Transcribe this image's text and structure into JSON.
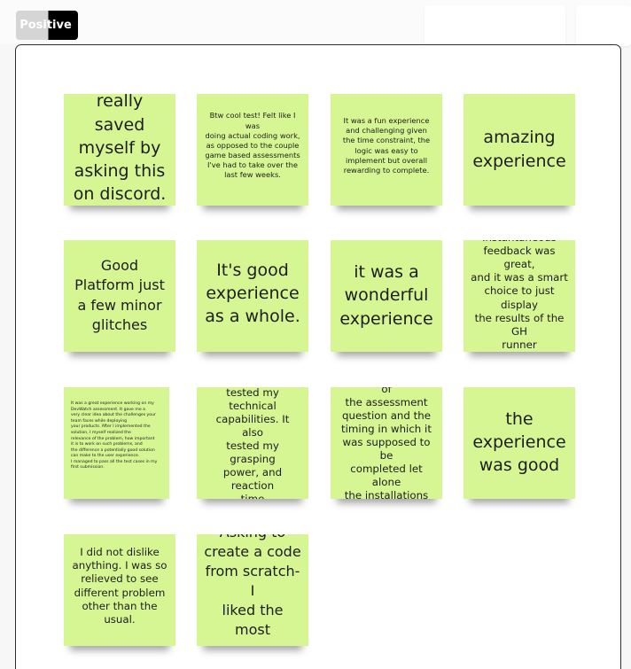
{
  "board": {
    "tag_label": "Positive",
    "notes": [
      {
        "text": "really saved\nmyself by\nasking this\non discord."
      },
      {
        "text": "Btw cool test! Felt like I was\ndoing actual coding work,\nas opposed to the couple\ngame based assessments\nI've had to take over the\nlast few weeks."
      },
      {
        "text": "It was a fun experience\nand challenging given\nthe time constraint, the\nlogic was easy to\nimplement but overall\nrewarding to complete."
      },
      {
        "text": "amazing\nexperience"
      },
      {
        "text": "Good\nPlatform just\na few minor\nglitches"
      },
      {
        "text": "It's good\nexperience\nas a whole."
      },
      {
        "text": "it was a\nwonderful\nexperience"
      },
      {
        "text": "Instantaneous\nfeedback was great,\nand it was a smart\nchoice to just display\nthe results of the GH\nrunner"
      },
      {
        "text": "It was a great experience working on my\nDevWatch assessment. It gave me a\nvery clear idea about the challenges your\nteam faces while deploying\nyour products. After I implemented the\nsolution, I myself realized the\nrelevance of the problem, how important\nit is to work on such problems, and\nthe difference a potentially good solution\ncan make to the user experience.\nI managed to pass all the test cases in my\nfirst submission."
      },
      {
        "text": "It was great! It\ntested my technical\ncapabilities. It also\ntested my grasping\npower, and reaction\ntime"
      },
      {
        "text": "The realisticness of\nthe assessment\nquestion and the\ntiming in which it\nwas supposed to be\ncompleted let alone\nthe installations"
      },
      {
        "text": "the\nexperience\nwas good"
      },
      {
        "text": "I did not dislike\nanything. I was so\nrelieved to see\ndifferent problem\nother than the\nusual."
      },
      {
        "text": "Asking to\ncreate a code\nfrom scratch- I\nliked the most"
      }
    ]
  }
}
